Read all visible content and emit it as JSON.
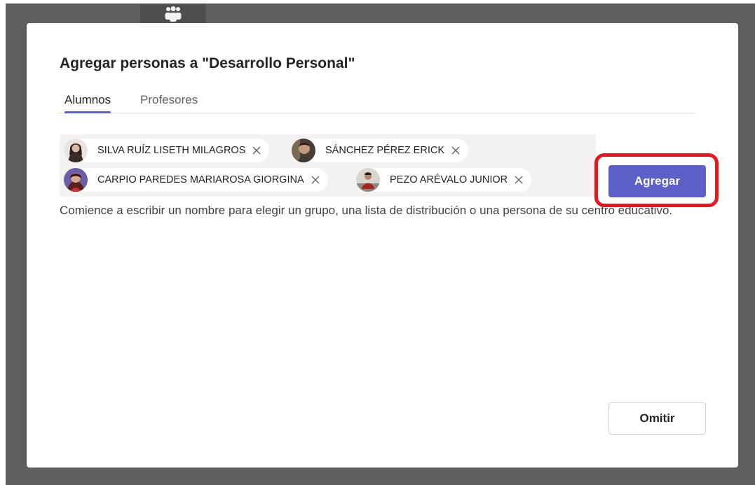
{
  "dialog": {
    "title": "Agregar personas a \"Desarrollo Personal\"",
    "tabs": [
      {
        "label": "Alumnos",
        "active": true
      },
      {
        "label": "Profesores",
        "active": false
      }
    ],
    "selected_people": [
      {
        "name": "SILVA RUÍZ LISETH MILAGROS"
      },
      {
        "name": "SÁNCHEZ PÉREZ ERICK"
      },
      {
        "name": "CARPIO PAREDES MARIAROSA GIORGINA"
      },
      {
        "name": "PEZO ARÉVALO JUNIOR"
      }
    ],
    "helper_text": "Comience a escribir un nombre para elegir un grupo, una lista de distribución o una persona de su centro educativo.",
    "add_label": "Agregar",
    "skip_label": "Omitir"
  },
  "colors": {
    "accent": "#5b5fc7",
    "highlight": "#e8151b",
    "backdrop": "#605e5c"
  },
  "icons": {
    "top": "people-team-icon",
    "remove": "close-icon"
  }
}
